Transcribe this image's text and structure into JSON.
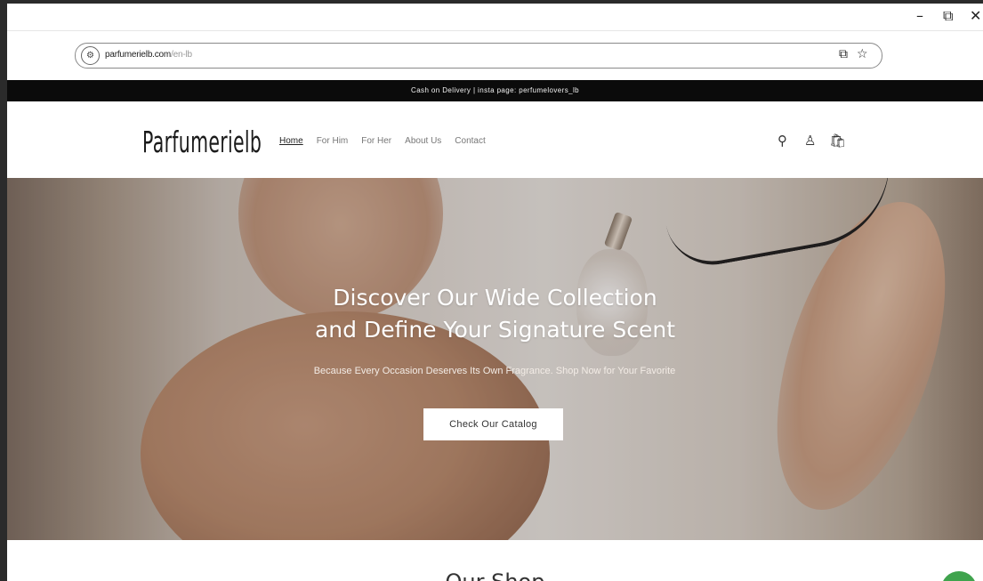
{
  "window": {
    "controls": {
      "minimize": "–",
      "maximize": "⧉",
      "close": "✕"
    }
  },
  "address_bar": {
    "domain": "parfumerielb.com",
    "path": "/en-lb",
    "icons": [
      "site-info-icon",
      "install-app-icon",
      "bookmark-star-icon"
    ]
  },
  "announcement": {
    "text": "Cash on Delivery | insta page: perfumelovers_lb"
  },
  "header": {
    "logo": "Parfumerielb",
    "nav": [
      {
        "label": "Home",
        "active": true
      },
      {
        "label": "For Him",
        "active": false
      },
      {
        "label": "For Her",
        "active": false
      },
      {
        "label": "About Us",
        "active": false
      },
      {
        "label": "Contact",
        "active": false
      }
    ],
    "icons": {
      "search": "⚲",
      "account": "♙",
      "cart": "🛍"
    }
  },
  "hero": {
    "title_line1": "Discover Our Wide Collection",
    "title_line2": "and Define Your Signature Scent",
    "subtitle": "Because Every Occasion Deserves Its Own Fragrance. Shop Now for Your Favorite",
    "button": "Check Our Catalog"
  },
  "shop": {
    "title": "Our Shop"
  },
  "colors": {
    "announcement_bg": "#0b0b0b",
    "chat_button": "#3fa34d"
  }
}
